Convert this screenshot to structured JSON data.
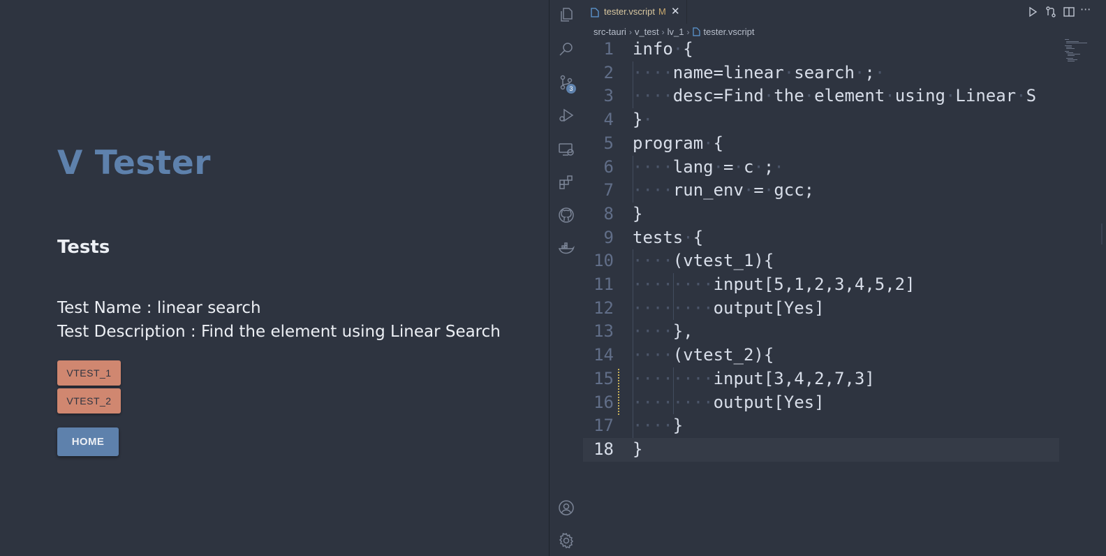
{
  "app": {
    "title": "V Tester",
    "section_heading": "Tests",
    "test_name_line": "Test Name : linear search",
    "test_description_line": "Test Description : Find the element using Linear Search",
    "buttons": {
      "vtest_1": "VTEST_1",
      "vtest_2": "VTEST_2",
      "home": "HOME"
    }
  },
  "activity_bar": {
    "icons": [
      "explorer-icon",
      "search-icon",
      "source-control-icon",
      "run-debug-icon",
      "remote-explorer-icon",
      "extensions-icon",
      "github-icon",
      "docker-icon",
      "account-icon",
      "settings-gear-icon"
    ],
    "scm_badge": "3"
  },
  "editor": {
    "tab": {
      "label": "tester.vscript",
      "modified_marker": "M",
      "close": "✕"
    },
    "toolbar_more": "···",
    "breadcrumb": [
      "src-tauri",
      "v_test",
      "lv_1",
      "tester.vscript"
    ],
    "lines": [
      {
        "n": "1",
        "text": "info·{"
      },
      {
        "n": "2",
        "text": "····name=linear·search·;·"
      },
      {
        "n": "3",
        "text": "····desc=Find·the·element·using·Linear·S"
      },
      {
        "n": "4",
        "text": "}·"
      },
      {
        "n": "5",
        "text": "program·{"
      },
      {
        "n": "6",
        "text": "····lang·=·c·;·"
      },
      {
        "n": "7",
        "text": "····run_env·=·gcc;"
      },
      {
        "n": "8",
        "text": "}"
      },
      {
        "n": "9",
        "text": "tests·{"
      },
      {
        "n": "10",
        "text": "····(vtest_1){"
      },
      {
        "n": "11",
        "text": "········input[5,1,2,3,4,5,2]"
      },
      {
        "n": "12",
        "text": "········output[Yes]"
      },
      {
        "n": "13",
        "text": "····},"
      },
      {
        "n": "14",
        "text": "····(vtest_2){"
      },
      {
        "n": "15",
        "text": "········input[3,4,2,7,3]"
      },
      {
        "n": "16",
        "text": "········output[Yes]"
      },
      {
        "n": "17",
        "text": "····}"
      },
      {
        "n": "18",
        "text": "}"
      }
    ],
    "current_line": "18"
  },
  "colors": {
    "background": "#2e3440",
    "title_blue": "#5e81ac",
    "vtest_button": "#d08770",
    "home_button": "#5e81ac",
    "foreground": "#eceff4"
  }
}
